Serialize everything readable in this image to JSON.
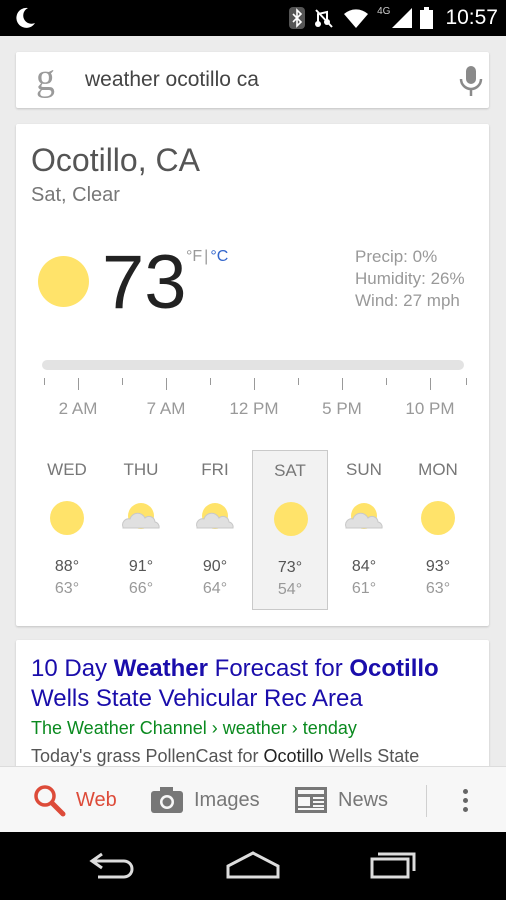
{
  "status_bar": {
    "time": "10:57",
    "network": "4G",
    "icons": [
      "moon-icon",
      "bluetooth-icon",
      "mute-icon",
      "wifi-icon",
      "signal-icon",
      "battery-icon"
    ]
  },
  "search": {
    "logo_letter": "g",
    "query": "weather ocotillo ca",
    "mic_icon": "microphone-icon"
  },
  "weather": {
    "location": "Ocotillo, CA",
    "condition": "Sat, Clear",
    "temperature": "73",
    "unit_f": "°F",
    "unit_sep": "|",
    "unit_c": "°C",
    "precip": "Precip: 0%",
    "humidity": "Humidity: 26%",
    "wind": "Wind: 27 mph",
    "times": [
      "2 AM",
      "7 AM",
      "12 PM",
      "5 PM",
      "10 PM"
    ],
    "days": [
      {
        "name": "WED",
        "icon": "sunny",
        "hi": "88°",
        "lo": "63°"
      },
      {
        "name": "THU",
        "icon": "partly-cloudy",
        "hi": "91°",
        "lo": "66°"
      },
      {
        "name": "FRI",
        "icon": "partly-cloudy",
        "hi": "90°",
        "lo": "64°"
      },
      {
        "name": "SAT",
        "icon": "sunny",
        "hi": "73°",
        "lo": "54°",
        "selected": true
      },
      {
        "name": "SUN",
        "icon": "partly-cloudy",
        "hi": "84°",
        "lo": "61°"
      },
      {
        "name": "MON",
        "icon": "sunny",
        "hi": "93°",
        "lo": "63°"
      }
    ]
  },
  "result": {
    "title_1": "10 Day ",
    "title_2": "Weather",
    "title_3": " Forecast for ",
    "title_4": "Ocotillo",
    "title_5": "Wells State Vehicular Rec Area",
    "url": "The Weather Channel › weather › tenday",
    "snippet_1": "Today's grass PollenCast for ",
    "snippet_2": "Ocotillo",
    "snippet_3": " Wells State"
  },
  "tabs": {
    "web": "Web",
    "images": "Images",
    "news": "News"
  },
  "colors": {
    "sun": "#ffe36a",
    "link": "#1a0dab",
    "url": "#0a8a1f",
    "active_tab": "#dd4b39"
  }
}
